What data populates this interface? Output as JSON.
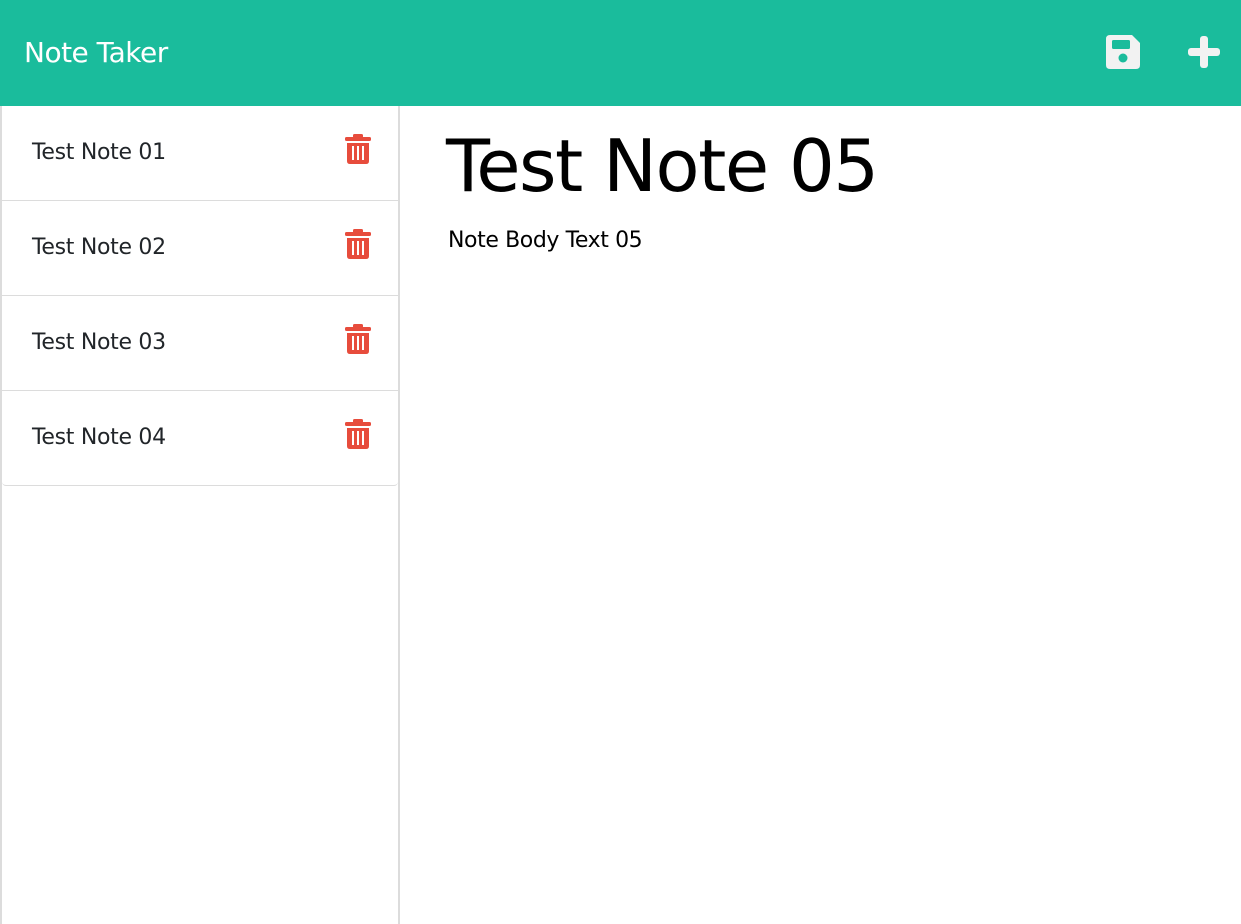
{
  "app": {
    "title": "Note Taker",
    "accent_color": "#1abc9c",
    "delete_color": "#e74c3c"
  },
  "toolbar": {
    "save_icon": "floppy-disk-icon",
    "new_icon": "plus-icon"
  },
  "sidebar": {
    "notes": [
      {
        "title": "Test Note 01",
        "delete_icon": "trash-icon"
      },
      {
        "title": "Test Note 02",
        "delete_icon": "trash-icon"
      },
      {
        "title": "Test Note 03",
        "delete_icon": "trash-icon"
      },
      {
        "title": "Test Note 04",
        "delete_icon": "trash-icon"
      }
    ]
  },
  "editor": {
    "title": "Test Note 05",
    "body": "Note Body Text 05"
  }
}
